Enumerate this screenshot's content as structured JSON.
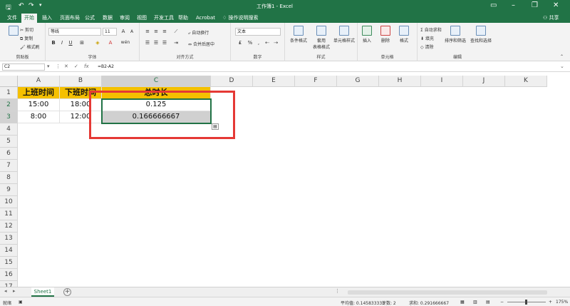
{
  "titlebar": {
    "doc_title": "工作簿1  -  Excel",
    "save_icon": "save-icon",
    "undo_icon": "undo-icon",
    "redo_icon": "redo-icon",
    "customize_icon": "chevron-down-icon",
    "window_controls": [
      "ribbon-display-icon",
      "minimize-icon",
      "restore-icon",
      "close-icon"
    ]
  },
  "tabs": {
    "items": [
      "文件",
      "开始",
      "插入",
      "页面布局",
      "公式",
      "数据",
      "审阅",
      "视图",
      "开发工具",
      "帮助",
      "Acrobat"
    ],
    "active": "开始",
    "tell_me": "操作说明搜索",
    "share": "共享"
  },
  "ribbon": {
    "clipboard": {
      "label": "剪贴板",
      "cut": "剪切",
      "copy": "复制",
      "format_painter": "格式刷"
    },
    "font": {
      "label": "字体",
      "font_name": "等线",
      "font_size": "11",
      "bold": "B",
      "italic": "I",
      "underline": "U",
      "wen": "wén",
      "grow": "A",
      "shrink": "A"
    },
    "alignment": {
      "label": "对齐方式",
      "wrap": "自动换行",
      "merge": "合并后居中"
    },
    "number": {
      "label": "数字",
      "format": "文本",
      "percent": "%",
      "comma": ","
    },
    "styles": {
      "label": "样式",
      "conditional": "条件格式",
      "table": "套用\n表格格式",
      "cell_styles": "单元格样式"
    },
    "cells": {
      "label": "单元格",
      "insert": "插入",
      "delete": "删除",
      "format": "格式"
    },
    "editing": {
      "label": "编辑",
      "autosum": "自动求和",
      "fill": "填充",
      "clear": "清除",
      "sort": "排序和筛选",
      "find": "查找和选择"
    },
    "accent_color": "#217346"
  },
  "formula_bar": {
    "name_box": "C2",
    "cancel": "✕",
    "enter": "✓",
    "fx": "fx",
    "formula": "=B2-A2"
  },
  "sheet": {
    "columns": [
      "A",
      "B",
      "C",
      "D",
      "E",
      "F",
      "G",
      "H",
      "I",
      "J",
      "K"
    ],
    "rows": [
      "1",
      "2",
      "3",
      "4",
      "5",
      "6",
      "7",
      "8",
      "9",
      "10",
      "11",
      "12",
      "13",
      "14",
      "15",
      "16",
      "17"
    ],
    "selected_column": "C",
    "selected_rows": [
      "2",
      "3"
    ],
    "header_fill": "#f5c000",
    "cells": {
      "A1": "上班时间",
      "B1": "下班时间",
      "C1": "总时长",
      "A2": "15:00",
      "B2": "18:00",
      "C2": "0.125",
      "A3": "8:00",
      "B3": "12:00",
      "C3": "0.166666667"
    },
    "highlight_color": "#e53935"
  },
  "sheet_tabs": {
    "tab": "Sheet1",
    "add": "+"
  },
  "status": {
    "mode": "就绪",
    "average": "平均值: 0.145833333",
    "count": "计数: 2",
    "sum": "求和: 0.291666667",
    "zoom": "175%",
    "zoom_out": "−",
    "zoom_in": "+"
  }
}
